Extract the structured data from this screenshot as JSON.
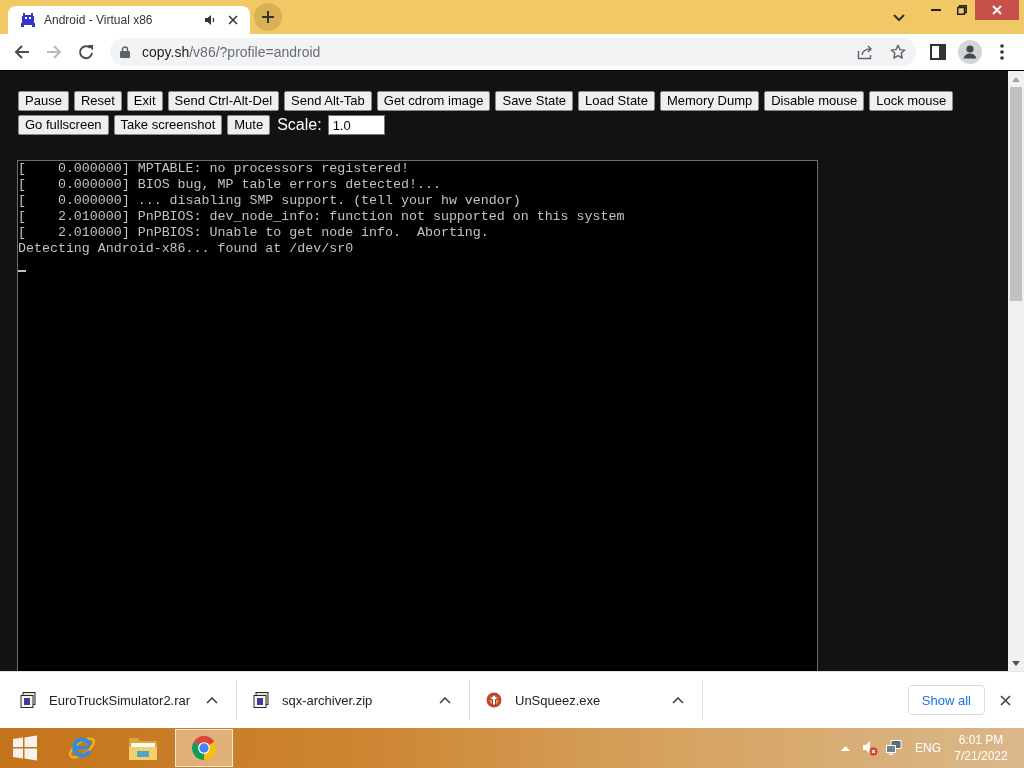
{
  "tabs": [
    {
      "title": "Android - Virtual x86",
      "selected": true
    }
  ],
  "toolbar": {
    "nav": [
      {
        "kind": "back",
        "disabled": false
      },
      {
        "kind": "forward",
        "disabled": true
      },
      {
        "kind": "reload",
        "disabled": false
      }
    ],
    "address": {
      "host": "copy.sh",
      "path": "/v86/?profile=android"
    }
  },
  "emulator": {
    "buttons": [
      "Pause",
      "Reset",
      "Exit",
      "Send Ctrl-Alt-Del",
      "Send Alt-Tab",
      "Get cdrom image",
      "Save State",
      "Load State",
      "Memory Dump",
      "Disable mouse",
      "Lock mouse",
      "Go fullscreen",
      "Take screenshot",
      "Mute"
    ],
    "scale": {
      "label": "Scale:",
      "value": "1.0"
    },
    "console": {
      "lines": [
        "[    0.000000] MPTABLE: no processors registered!",
        "[    0.000000] BIOS bug, MP table errors detected!...",
        "[    0.000000] ... disabling SMP support. (tell your hw vendor)",
        "[    2.010000] PnPBIOS: dev_node_info: function not supported on this system",
        "[    2.010000] PnPBIOS: Unable to get node info.  Aborting.",
        "Detecting Android-x86... found at /dev/sr0"
      ]
    }
  },
  "downloads": {
    "items": [
      {
        "name": "EuroTruckSimulator2.rar",
        "kind": "archive"
      },
      {
        "name": "sqx-archiver.zip",
        "kind": "archive"
      },
      {
        "name": "UnSqueez.exe",
        "kind": "program"
      }
    ],
    "show_all": "Show all"
  },
  "taskbar": {
    "apps": [
      {
        "kind": "ie",
        "selected": false
      },
      {
        "kind": "folder",
        "selected": false
      },
      {
        "kind": "chrome",
        "selected": true
      }
    ],
    "language": "ENG",
    "time": "6:01 PM",
    "date": "7/21/2022"
  }
}
